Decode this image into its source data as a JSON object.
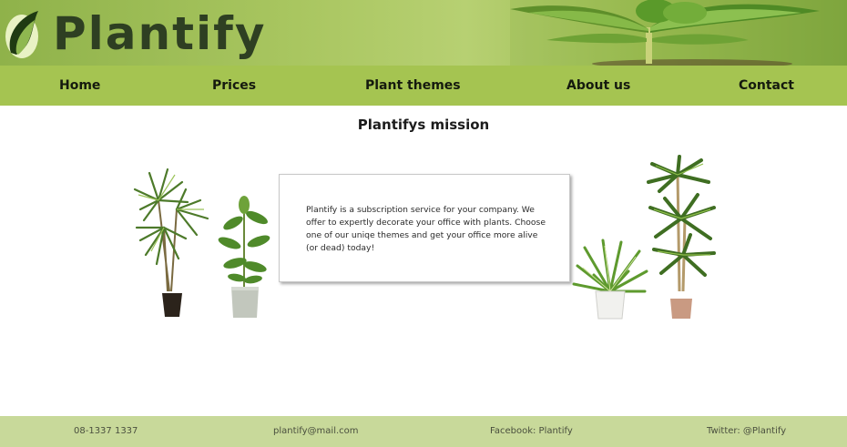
{
  "brand": {
    "name": "Plantify",
    "logo_icon": "leaf-logo-icon"
  },
  "nav": {
    "items": [
      {
        "label": "Home"
      },
      {
        "label": "Prices"
      },
      {
        "label": "Plant themes"
      },
      {
        "label": "About us"
      },
      {
        "label": "Contact"
      }
    ]
  },
  "main": {
    "title": "Plantifys mission",
    "mission_text": "Plantify is a subscription service for your company. We offer to expertly decorate your office with plants. Choose one of our uniqe themes and get your office more alive (or dead) today!"
  },
  "footer": {
    "phone": "08-1337 1337",
    "email": "plantify@mail.com",
    "facebook": "Facebook: Plantify",
    "twitter": "Twitter: @Plantify"
  },
  "colors": {
    "nav_bg": "#a5c451",
    "footer_bg": "#c8d99a",
    "brand_text": "#2e3f22"
  }
}
